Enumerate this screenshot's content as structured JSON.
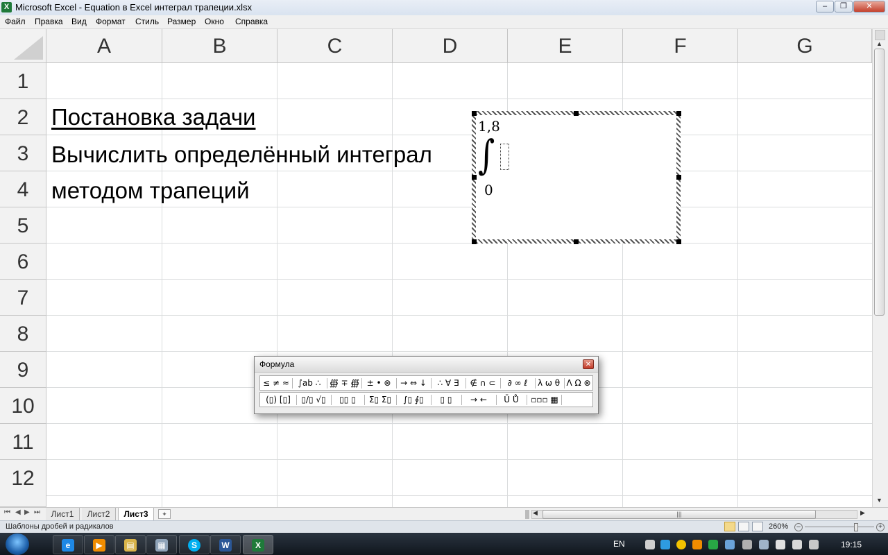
{
  "window": {
    "title": "Microsoft Excel - Equation в Excel интеграл трапеции.xlsx",
    "app_icon": "X",
    "controls": {
      "minimize": "–",
      "restore": "❐",
      "close": "✕"
    }
  },
  "menu": [
    "Файл",
    "Правка",
    "Вид",
    "Формат",
    "Стиль",
    "Размер",
    "Окно",
    "Справка"
  ],
  "columns": [
    "A",
    "B",
    "C",
    "D",
    "E",
    "F",
    "G"
  ],
  "rows": [
    "1",
    "2",
    "3",
    "4",
    "5",
    "6",
    "7",
    "8",
    "9",
    "10",
    "11",
    "12"
  ],
  "cells": {
    "A2": "Постановка задачи",
    "A3": "Вычислить определённый интеграл",
    "A4": "методом трапеций"
  },
  "equation": {
    "upper_limit": "1,8",
    "lower_limit": "0",
    "symbol": "∫"
  },
  "formula_toolbar": {
    "title": "Формула",
    "close": "✕",
    "row1": [
      "≤ ≠ ≈",
      "∫ab ∴",
      "∰ ∓ ∰",
      "± • ⊗",
      "→ ⇔ ↓",
      "∴ ∀ ∃",
      "∉ ∩ ⊂",
      "∂ ∞ ℓ",
      "λ ω θ",
      "Λ Ω ⊗"
    ],
    "row2": [
      "(▯) [▯]",
      "▯/▯ √▯",
      "▯▯ ▯",
      "Σ▯ Σ▯",
      "∫▯ ∮▯",
      "▯ ▯",
      "→ ←",
      "Ū Ů",
      "▫▫▫ ▦"
    ]
  },
  "sheet_tabs": [
    "Лист1",
    "Лист2",
    "Лист3"
  ],
  "active_tab": "Лист3",
  "status": {
    "text": "Шаблоны дробей и радикалов",
    "zoom": "260%"
  },
  "taskbar": {
    "lang": "EN",
    "time": "19:15",
    "apps": [
      {
        "name": "ie",
        "glyph": "e",
        "color": "#1e88e5"
      },
      {
        "name": "media-player",
        "glyph": "▶",
        "color": "#f08c00"
      },
      {
        "name": "file-explorer",
        "glyph": "▤",
        "color": "#d9b44a"
      },
      {
        "name": "calculator",
        "glyph": "▦",
        "color": "#8fa3b8"
      },
      {
        "name": "skype",
        "glyph": "S",
        "color": "#00aff0"
      },
      {
        "name": "word",
        "glyph": "W",
        "color": "#2b5797"
      },
      {
        "name": "excel",
        "glyph": "X",
        "color": "#1f7a3a"
      }
    ]
  }
}
